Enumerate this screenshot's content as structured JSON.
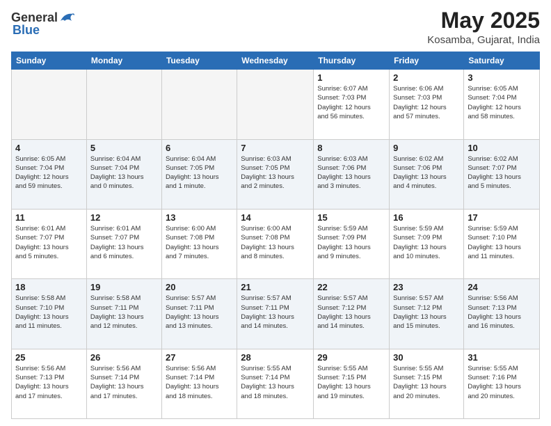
{
  "header": {
    "logo_general": "General",
    "logo_blue": "Blue",
    "month": "May 2025",
    "location": "Kosamba, Gujarat, India"
  },
  "weekdays": [
    "Sunday",
    "Monday",
    "Tuesday",
    "Wednesday",
    "Thursday",
    "Friday",
    "Saturday"
  ],
  "weeks": [
    [
      {
        "day": "",
        "info": ""
      },
      {
        "day": "",
        "info": ""
      },
      {
        "day": "",
        "info": ""
      },
      {
        "day": "",
        "info": ""
      },
      {
        "day": "1",
        "info": "Sunrise: 6:07 AM\nSunset: 7:03 PM\nDaylight: 12 hours\nand 56 minutes."
      },
      {
        "day": "2",
        "info": "Sunrise: 6:06 AM\nSunset: 7:03 PM\nDaylight: 12 hours\nand 57 minutes."
      },
      {
        "day": "3",
        "info": "Sunrise: 6:05 AM\nSunset: 7:04 PM\nDaylight: 12 hours\nand 58 minutes."
      }
    ],
    [
      {
        "day": "4",
        "info": "Sunrise: 6:05 AM\nSunset: 7:04 PM\nDaylight: 12 hours\nand 59 minutes."
      },
      {
        "day": "5",
        "info": "Sunrise: 6:04 AM\nSunset: 7:04 PM\nDaylight: 13 hours\nand 0 minutes."
      },
      {
        "day": "6",
        "info": "Sunrise: 6:04 AM\nSunset: 7:05 PM\nDaylight: 13 hours\nand 1 minute."
      },
      {
        "day": "7",
        "info": "Sunrise: 6:03 AM\nSunset: 7:05 PM\nDaylight: 13 hours\nand 2 minutes."
      },
      {
        "day": "8",
        "info": "Sunrise: 6:03 AM\nSunset: 7:06 PM\nDaylight: 13 hours\nand 3 minutes."
      },
      {
        "day": "9",
        "info": "Sunrise: 6:02 AM\nSunset: 7:06 PM\nDaylight: 13 hours\nand 4 minutes."
      },
      {
        "day": "10",
        "info": "Sunrise: 6:02 AM\nSunset: 7:07 PM\nDaylight: 13 hours\nand 5 minutes."
      }
    ],
    [
      {
        "day": "11",
        "info": "Sunrise: 6:01 AM\nSunset: 7:07 PM\nDaylight: 13 hours\nand 5 minutes."
      },
      {
        "day": "12",
        "info": "Sunrise: 6:01 AM\nSunset: 7:07 PM\nDaylight: 13 hours\nand 6 minutes."
      },
      {
        "day": "13",
        "info": "Sunrise: 6:00 AM\nSunset: 7:08 PM\nDaylight: 13 hours\nand 7 minutes."
      },
      {
        "day": "14",
        "info": "Sunrise: 6:00 AM\nSunset: 7:08 PM\nDaylight: 13 hours\nand 8 minutes."
      },
      {
        "day": "15",
        "info": "Sunrise: 5:59 AM\nSunset: 7:09 PM\nDaylight: 13 hours\nand 9 minutes."
      },
      {
        "day": "16",
        "info": "Sunrise: 5:59 AM\nSunset: 7:09 PM\nDaylight: 13 hours\nand 10 minutes."
      },
      {
        "day": "17",
        "info": "Sunrise: 5:59 AM\nSunset: 7:10 PM\nDaylight: 13 hours\nand 11 minutes."
      }
    ],
    [
      {
        "day": "18",
        "info": "Sunrise: 5:58 AM\nSunset: 7:10 PM\nDaylight: 13 hours\nand 11 minutes."
      },
      {
        "day": "19",
        "info": "Sunrise: 5:58 AM\nSunset: 7:11 PM\nDaylight: 13 hours\nand 12 minutes."
      },
      {
        "day": "20",
        "info": "Sunrise: 5:57 AM\nSunset: 7:11 PM\nDaylight: 13 hours\nand 13 minutes."
      },
      {
        "day": "21",
        "info": "Sunrise: 5:57 AM\nSunset: 7:11 PM\nDaylight: 13 hours\nand 14 minutes."
      },
      {
        "day": "22",
        "info": "Sunrise: 5:57 AM\nSunset: 7:12 PM\nDaylight: 13 hours\nand 14 minutes."
      },
      {
        "day": "23",
        "info": "Sunrise: 5:57 AM\nSunset: 7:12 PM\nDaylight: 13 hours\nand 15 minutes."
      },
      {
        "day": "24",
        "info": "Sunrise: 5:56 AM\nSunset: 7:13 PM\nDaylight: 13 hours\nand 16 minutes."
      }
    ],
    [
      {
        "day": "25",
        "info": "Sunrise: 5:56 AM\nSunset: 7:13 PM\nDaylight: 13 hours\nand 17 minutes."
      },
      {
        "day": "26",
        "info": "Sunrise: 5:56 AM\nSunset: 7:14 PM\nDaylight: 13 hours\nand 17 minutes."
      },
      {
        "day": "27",
        "info": "Sunrise: 5:56 AM\nSunset: 7:14 PM\nDaylight: 13 hours\nand 18 minutes."
      },
      {
        "day": "28",
        "info": "Sunrise: 5:55 AM\nSunset: 7:14 PM\nDaylight: 13 hours\nand 18 minutes."
      },
      {
        "day": "29",
        "info": "Sunrise: 5:55 AM\nSunset: 7:15 PM\nDaylight: 13 hours\nand 19 minutes."
      },
      {
        "day": "30",
        "info": "Sunrise: 5:55 AM\nSunset: 7:15 PM\nDaylight: 13 hours\nand 20 minutes."
      },
      {
        "day": "31",
        "info": "Sunrise: 5:55 AM\nSunset: 7:16 PM\nDaylight: 13 hours\nand 20 minutes."
      }
    ]
  ]
}
